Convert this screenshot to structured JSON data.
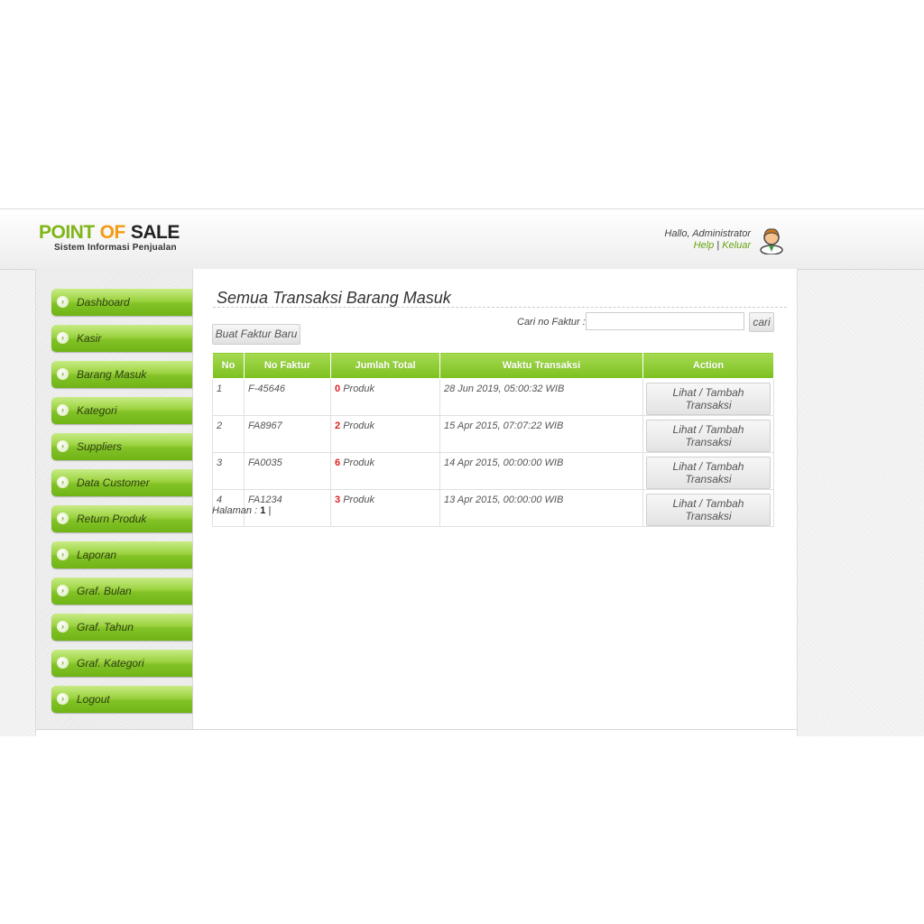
{
  "brand": {
    "word1": "POINT",
    "word2": "OF",
    "word3": "SALE",
    "subtitle": "Sistem Informasi Penjualan"
  },
  "user": {
    "greeting": "Hallo, Administrator",
    "help": "Help",
    "separator": "|",
    "logout": "Keluar"
  },
  "sidebar": {
    "items": [
      {
        "label": "Dashboard"
      },
      {
        "label": "Kasir"
      },
      {
        "label": "Barang Masuk"
      },
      {
        "label": "Kategori"
      },
      {
        "label": "Suppliers"
      },
      {
        "label": "Data Customer"
      },
      {
        "label": "Return Produk"
      },
      {
        "label": "Laporan"
      },
      {
        "label": "Graf. Bulan"
      },
      {
        "label": "Graf. Tahun"
      },
      {
        "label": "Graf. Kategori"
      },
      {
        "label": "Logout"
      }
    ]
  },
  "main": {
    "title": "Semua Transaksi Barang Masuk",
    "new_button": "Buat Faktur Baru",
    "search": {
      "label": "Cari no Faktur :",
      "value": "",
      "button": "cari"
    },
    "table": {
      "headers": [
        "No",
        "No Faktur",
        "Jumlah Total",
        "Waktu Transaksi",
        "Action"
      ],
      "rows": [
        {
          "no": "1",
          "faktur": "F-45646",
          "qty": "0",
          "unit": "Produk",
          "waktu": "28 Jun 2019, 05:00:32 WIB",
          "action": "Lihat / Tambah Transaksi"
        },
        {
          "no": "2",
          "faktur": "FA8967",
          "qty": "2",
          "unit": "Produk",
          "waktu": "15 Apr 2015, 07:07:22 WIB",
          "action": "Lihat / Tambah Transaksi"
        },
        {
          "no": "3",
          "faktur": "FA0035",
          "qty": "6",
          "unit": "Produk",
          "waktu": "14 Apr 2015, 00:00:00 WIB",
          "action": "Lihat / Tambah Transaksi"
        },
        {
          "no": "4",
          "faktur": "FA1234",
          "qty": "3",
          "unit": "Produk",
          "waktu": "13 Apr 2015, 00:00:00 WIB",
          "action": "Lihat / Tambah Transaksi"
        }
      ]
    },
    "pager": {
      "label": "Halaman :",
      "current": "1",
      "separator": "|"
    }
  },
  "colors": {
    "accent_green": "#7cc01f",
    "logo_orange": "#f39a14",
    "quantity_red": "#e01e1e"
  },
  "icons": {
    "avatar": "user-avatar-icon",
    "menu_bullet": "chevron-right-icon"
  }
}
